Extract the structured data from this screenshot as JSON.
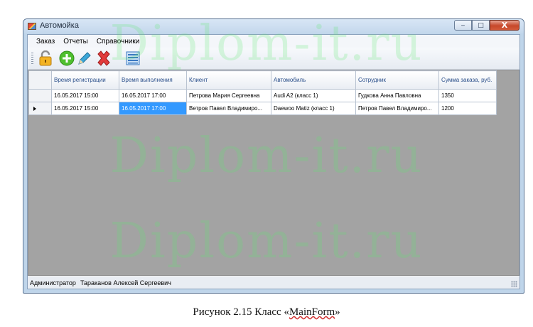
{
  "window": {
    "title": "Автомойка",
    "controls": {
      "minimize": "‒",
      "maximize": "□",
      "close": "X"
    }
  },
  "menu": [
    {
      "label": "Заказ"
    },
    {
      "label": "Отчеты"
    },
    {
      "label": "Справочники"
    }
  ],
  "toolbar": {
    "buttons": [
      {
        "icon": "lock-icon"
      },
      {
        "icon": "add-icon"
      },
      {
        "icon": "edit-pencil-icon"
      },
      {
        "icon": "delete-icon"
      },
      {
        "icon": "list-icon"
      }
    ]
  },
  "grid": {
    "columns": [
      {
        "label": "Время регистрации"
      },
      {
        "label": "Время выполнения"
      },
      {
        "label": "Клиент"
      },
      {
        "label": "Автомобиль"
      },
      {
        "label": "Сотрудник"
      },
      {
        "label": "Сумма заказа, руб."
      }
    ],
    "rows": [
      {
        "registered": "16.05.2017 15:00",
        "completed": "16.05.2017 17:00",
        "client": "Петрова Мария Сергеевна",
        "car": "Audi A2 (класс 1)",
        "employee": "Гудкова Анна Павловна",
        "amount": "1350",
        "current": false
      },
      {
        "registered": "16.05.2017 15:00",
        "completed": "16.05.2017 17:00",
        "client": "Ветров Павел Владимиро...",
        "car": "Daewoo Matiz (класс 1)",
        "employee": "Петров Павел Владимиро...",
        "amount": "1200",
        "current": true
      }
    ],
    "selected_cell": {
      "row": 1,
      "column": "completed"
    }
  },
  "status": {
    "role": "Администратор",
    "user": "Тараканов Алексей Сергеевич"
  },
  "caption": {
    "prefix": "Рисунок 2.15 Класс «",
    "class_name": "MainForm",
    "suffix": "»"
  },
  "watermark": {
    "text": "Diplom-it.ru"
  },
  "colors": {
    "title_bar": "#c9dcf0",
    "grid_background": "#a3a3a3",
    "selection": "#3399ff",
    "close_button": "#c7482a",
    "watermark": "#5ae66e"
  }
}
